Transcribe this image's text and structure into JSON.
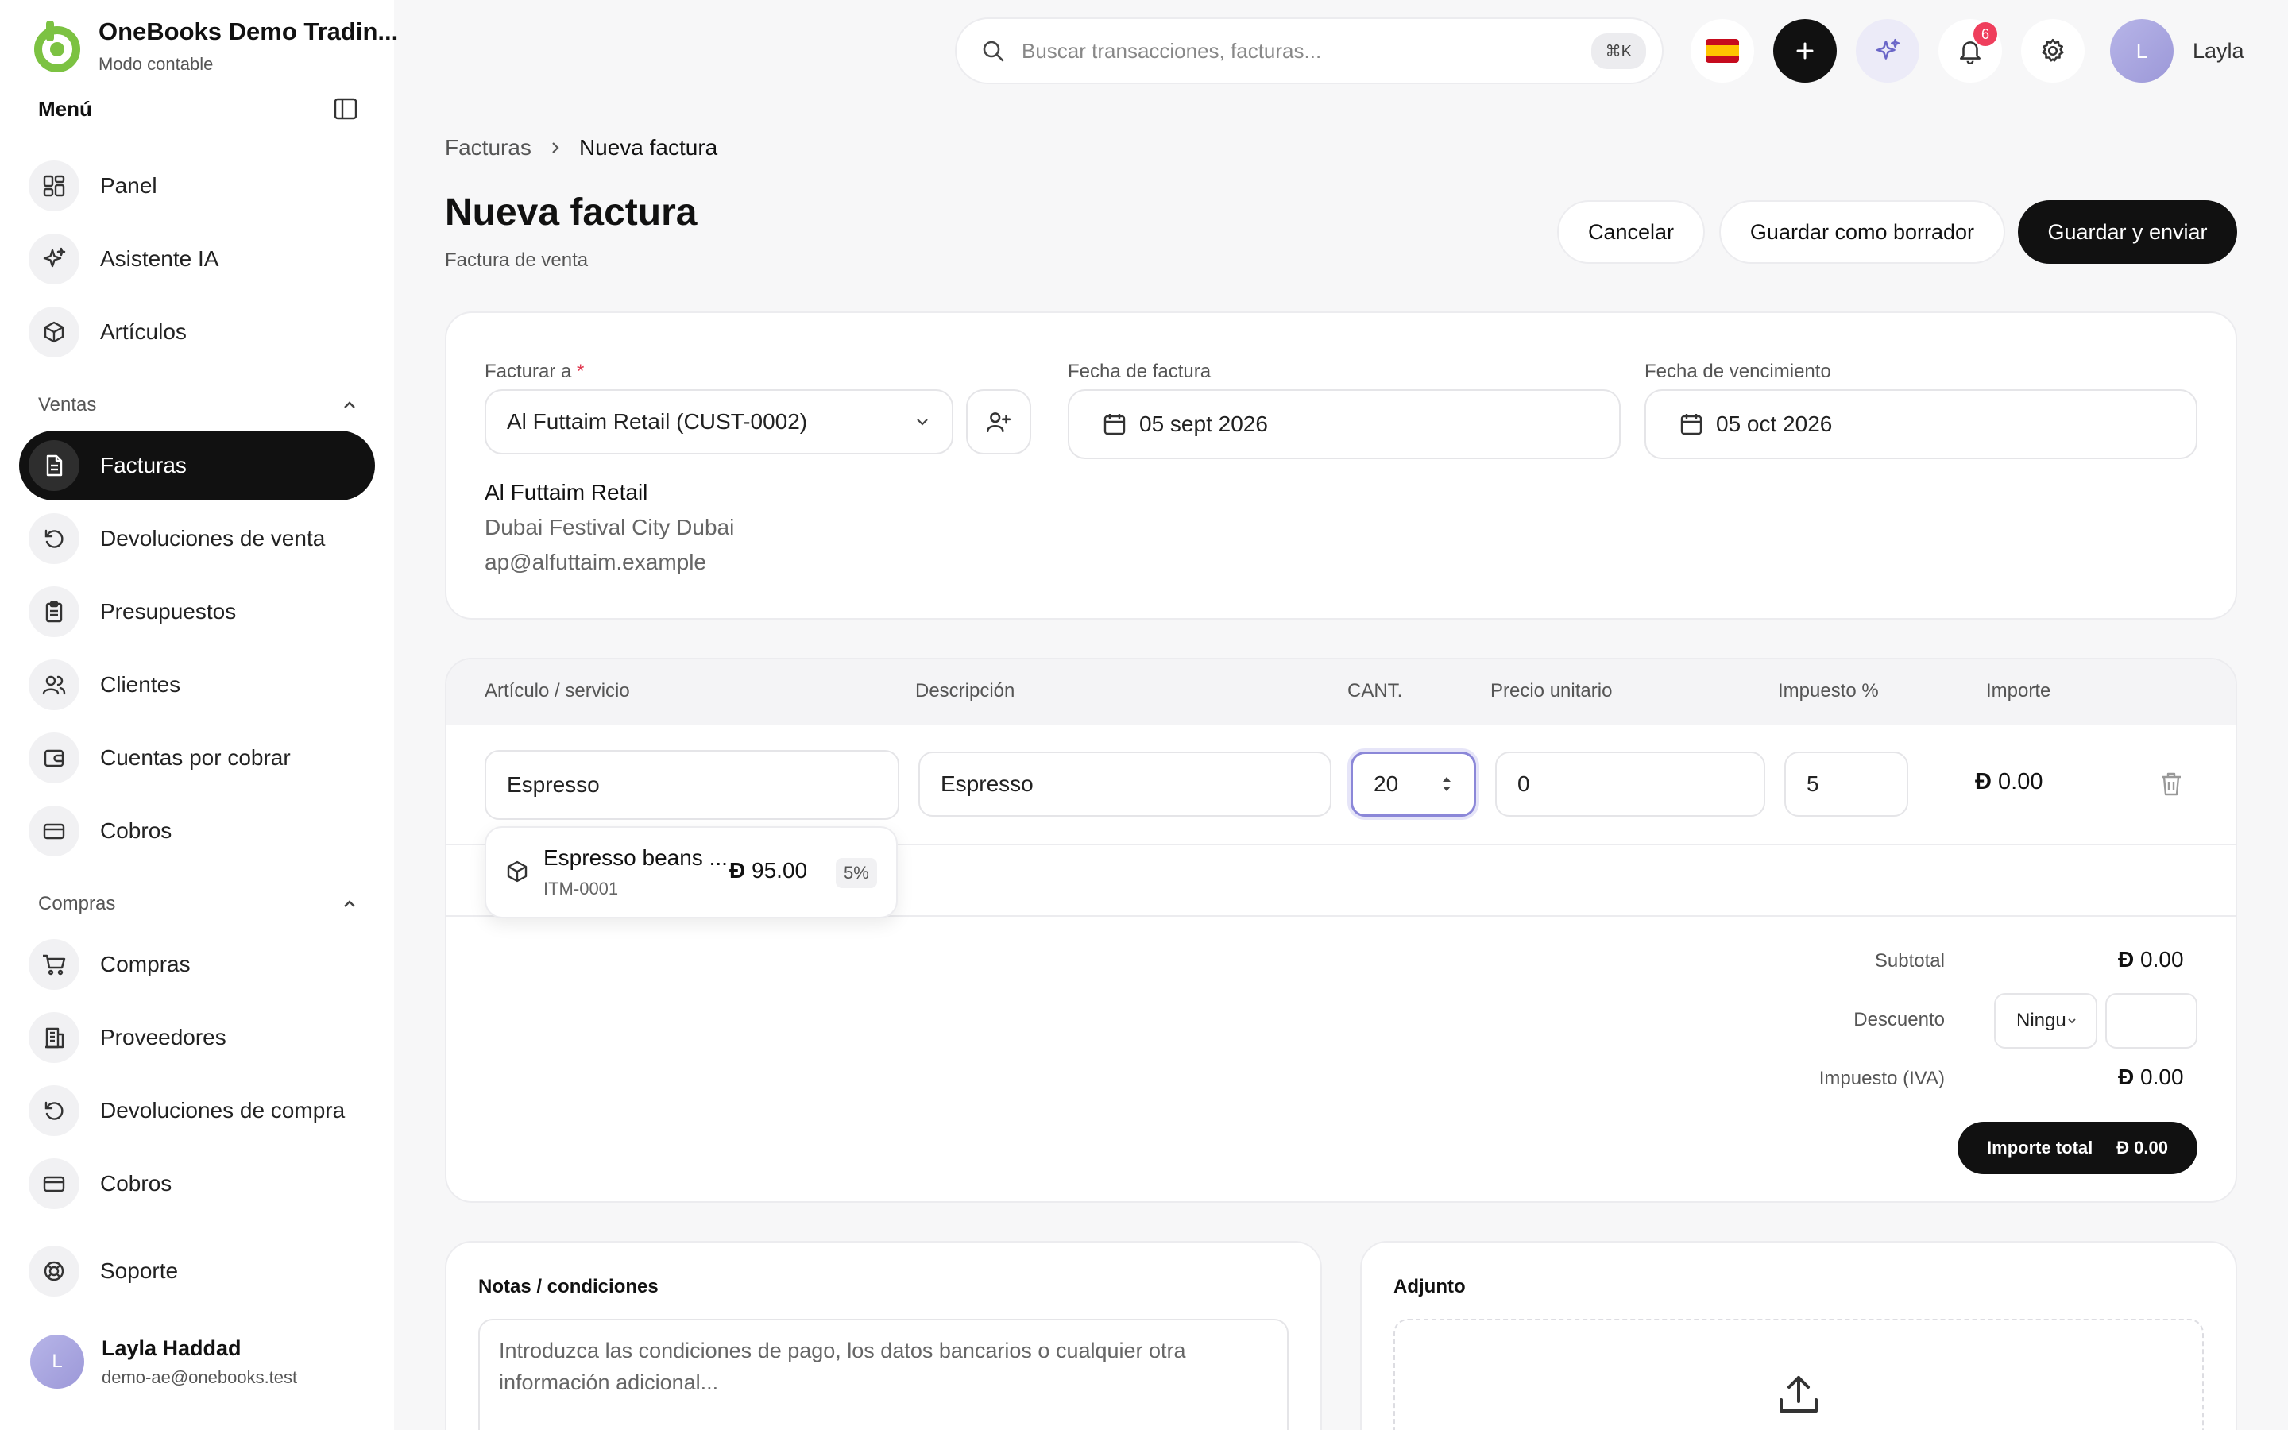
{
  "brand": {
    "name": "OneBooks Demo Tradin...",
    "subtitle": "Modo contable"
  },
  "sidebar": {
    "menu_label": "Menú",
    "top_items": [
      {
        "label": "Panel",
        "icon": "dashboard-icon"
      },
      {
        "label": "Asistente IA",
        "icon": "sparkles-icon"
      },
      {
        "label": "Artículos",
        "icon": "cube-icon"
      }
    ],
    "sales_label": "Ventas",
    "sales_items": [
      {
        "label": "Facturas",
        "icon": "document-icon",
        "active": true
      },
      {
        "label": "Devoluciones de venta",
        "icon": "return-icon"
      },
      {
        "label": "Presupuestos",
        "icon": "clipboard-icon"
      },
      {
        "label": "Clientes",
        "icon": "users-icon"
      },
      {
        "label": "Cuentas por cobrar",
        "icon": "wallet-icon"
      },
      {
        "label": "Cobros",
        "icon": "card-icon"
      }
    ],
    "purchases_label": "Compras",
    "purchase_items": [
      {
        "label": "Compras",
        "icon": "cart-icon"
      },
      {
        "label": "Proveedores",
        "icon": "building-icon"
      },
      {
        "label": "Devoluciones de compra",
        "icon": "return-icon"
      },
      {
        "label": "Cobros",
        "icon": "card-icon"
      }
    ],
    "support_label": "Soporte",
    "user": {
      "initial": "L",
      "name": "Layla Haddad",
      "email": "demo-ae@onebooks.test"
    }
  },
  "topbar": {
    "search_placeholder": "Buscar transacciones, facturas...",
    "shortcut": "⌘K",
    "notifications_count": "6",
    "user_initial": "L",
    "user_name": "Layla"
  },
  "breadcrumb": {
    "parent": "Facturas",
    "current": "Nueva factura"
  },
  "header": {
    "title": "Nueva factura",
    "subtitle": "Factura de venta",
    "cancel": "Cancelar",
    "save_draft": "Guardar como borrador",
    "save_send": "Guardar y enviar"
  },
  "invoice": {
    "bill_to_label": "Facturar a",
    "required_mark": "*",
    "customer": "Al Futtaim Retail (CUST-0002)",
    "invoice_date_label": "Fecha de factura",
    "invoice_date": "05 sept 2026",
    "due_date_label": "Fecha de vencimiento",
    "due_date": "05 oct 2026",
    "customer_name": "Al Futtaim Retail",
    "customer_address": "Dubai Festival City Dubai",
    "customer_email": "ap@alfuttaim.example"
  },
  "items": {
    "columns": [
      "Artículo / servicio",
      "Descripción",
      "CANT.",
      "Precio unitario",
      "Impuesto %",
      "Importe"
    ],
    "row": {
      "item": "Espresso",
      "description": "Espresso",
      "qty": "20",
      "price": "0",
      "tax": "5",
      "amount": "0.00"
    },
    "suggestion": {
      "name": "Espresso beans ...",
      "code": "ITM-0001",
      "price": "95.00",
      "tax": "5%"
    }
  },
  "totals": {
    "currency_symbol": "Đ",
    "subtotal_label": "Subtotal",
    "subtotal": "0.00",
    "discount_label": "Descuento",
    "discount_type": "Ningu",
    "tax_label": "Impuesto (IVA)",
    "tax": "0.00",
    "total_label": "Importe total",
    "total": "0.00"
  },
  "notes": {
    "title": "Notas / condiciones",
    "placeholder": "Introduzca las condiciones de pago, los datos bancarios o cualquier otra información adicional..."
  },
  "attachment": {
    "title": "Adjunto"
  },
  "colors": {
    "accent": "#111111",
    "brand_green": "#7cc242",
    "badge": "#ef3e5c",
    "avatar": "#a9a6e0"
  }
}
